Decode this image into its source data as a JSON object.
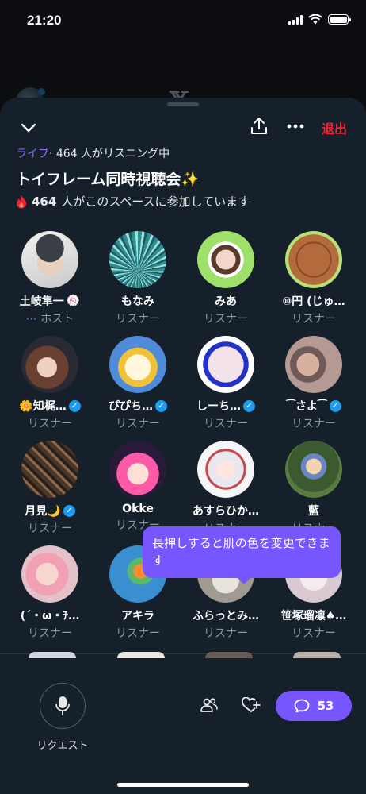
{
  "status_bar": {
    "time": "21:20"
  },
  "header": {
    "exit_label": "退出",
    "live_label": "ライブ",
    "listening_text": "· 464 人がリスニング中",
    "title": "トイフレーム同時視聴会✨",
    "participants_count": "464",
    "participants_text": "人がこのスペースに参加しています"
  },
  "participants": [
    {
      "name": "土岐隼一",
      "emoji": "🍥",
      "role": "ホスト",
      "role_prefix": "⋯",
      "verified": false
    },
    {
      "name": "もなみ",
      "role": "リスナー",
      "verified": false
    },
    {
      "name": "みあ",
      "role": "リスナー",
      "verified": false
    },
    {
      "name": "⑩円 (じゅ…",
      "role": "リスナー",
      "verified": false
    },
    {
      "name": "🌼知梶…",
      "role": "リスナー",
      "verified": true
    },
    {
      "name": "ぴぴち…",
      "role": "リスナー",
      "verified": true
    },
    {
      "name": "しーち…",
      "role": "リスナー",
      "verified": true
    },
    {
      "name": "⁀さよ⁀",
      "role": "リスナー",
      "verified": true
    },
    {
      "name": "月見🌙",
      "role": "リスナー",
      "verified": true
    },
    {
      "name": "Okke",
      "role": "リスナー",
      "verified": false
    },
    {
      "name": "あすらひか…",
      "role": "リスナー",
      "verified": false
    },
    {
      "name": "藍",
      "role": "リスナー",
      "verified": false
    },
    {
      "name": "(´・ω・ﾁ…",
      "role": "リスナー",
      "verified": false
    },
    {
      "name": "アキラ",
      "role": "リスナー",
      "verified": false
    },
    {
      "name": "ふらっとみ…",
      "role": "リスナー",
      "verified": false
    },
    {
      "name": "笹塚瑠凛♠…",
      "role": "リスナー",
      "verified": false
    }
  ],
  "tooltip": {
    "text": "長押しすると肌の色を変更できます"
  },
  "bottom_bar": {
    "request_label": "リクエスト",
    "comment_count": "53"
  },
  "colors": {
    "accent": "#7856ff",
    "live": "#8c6bff",
    "exit": "#f4212e",
    "verified": "#1d9bf0",
    "sheet_bg": "#15202b"
  },
  "icons": [
    "chevron-down-icon",
    "share-icon",
    "more-icon",
    "fire-icon",
    "verified-icon",
    "mic-icon",
    "people-icon",
    "heart-plus-icon",
    "comment-icon"
  ]
}
